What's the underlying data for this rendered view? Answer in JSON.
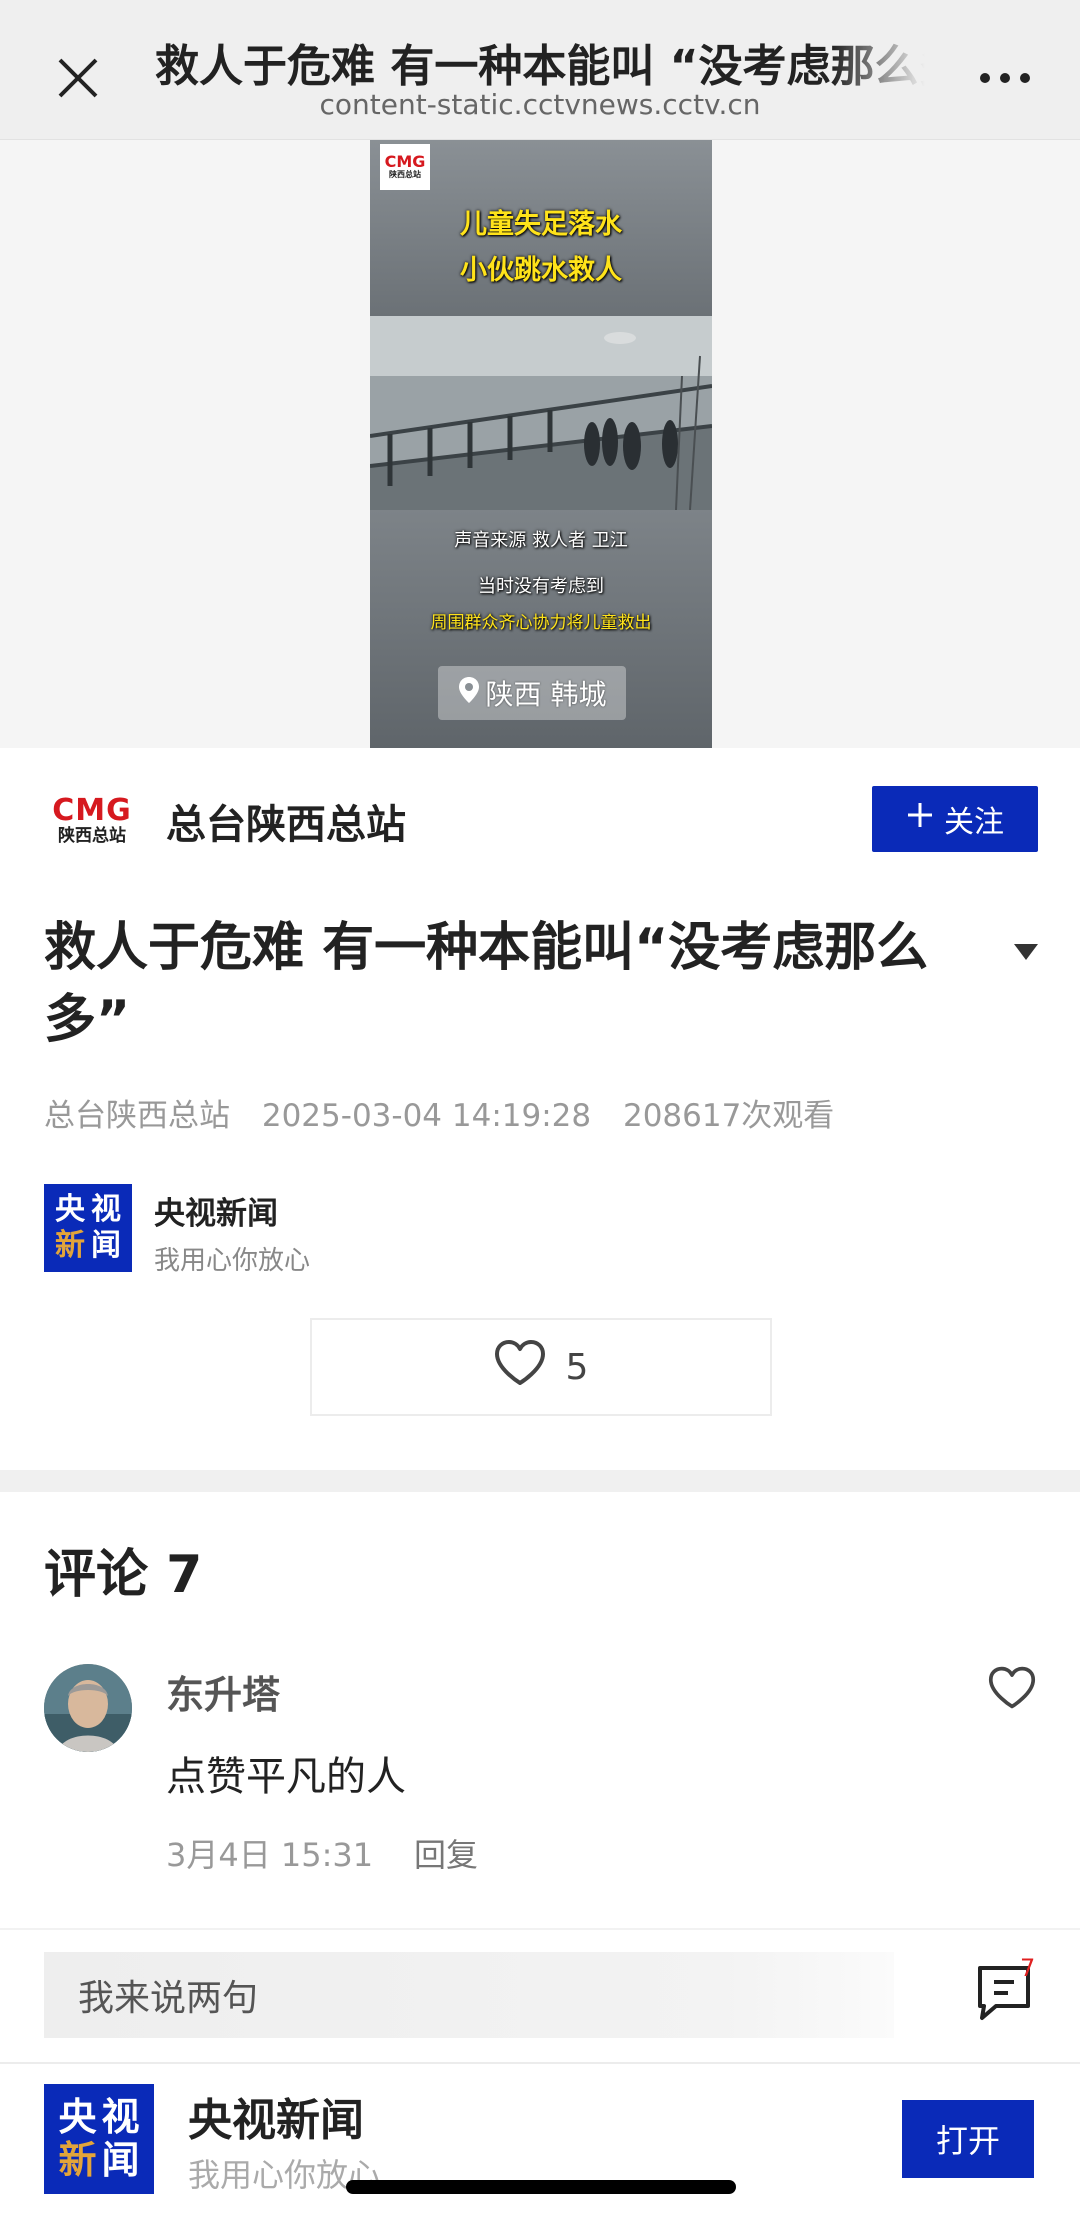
{
  "topbar": {
    "title": "救人于危难 有一种本能叫 “没考虑那么多”",
    "url": "content-static.cctvnews.cctv.cn"
  },
  "video": {
    "badge_logo": "CMG",
    "badge_region": "陕西总站",
    "headline_line1": "儿童失足落水",
    "headline_line2": "小伙跳水救人",
    "caption_source": "声音来源 救人者 卫江",
    "caption_line1": "当时没有考虑到",
    "caption_line2": "周围群众齐心协力将儿童救出",
    "location": "陕西 韩城"
  },
  "channel": {
    "logo_text": "CMG",
    "logo_region": "陕西总站",
    "name": "总台陕西总站",
    "follow_label": "关注"
  },
  "article": {
    "title": "救人于危难 有一种本能叫“没考虑那么多”",
    "author": "总台陕西总站",
    "datetime": "2025-03-04 14:19:28",
    "views": "208617次观看"
  },
  "source": {
    "logo_chars": [
      "央",
      "视",
      "新",
      "闻"
    ],
    "name": "央视新闻",
    "slogan": "我用心你放心"
  },
  "likes": {
    "count": "5"
  },
  "comments": {
    "title": "评论 7",
    "items": [
      {
        "user": "东升塔",
        "text": "点赞平凡的人",
        "time": "3月4日 15:31",
        "reply_label": "回复"
      }
    ],
    "input_placeholder": "我来说两句",
    "count_badge": "7"
  },
  "app_banner": {
    "logo_chars": [
      "央",
      "视",
      "新",
      "闻"
    ],
    "name": "央视新闻",
    "slogan": "我用心你放心",
    "open_label": "打开"
  },
  "colors": {
    "brand_blue": "#0a2ab8",
    "cmg_red": "#d6191f",
    "caption_yellow": "#ffe31a"
  }
}
